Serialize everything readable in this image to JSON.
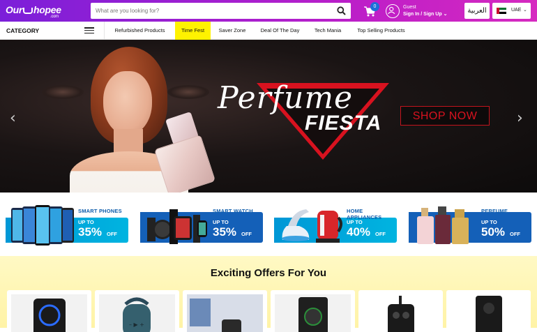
{
  "header": {
    "logo_text": "Our",
    "logo_text2": "hopee",
    "logo_sub": ".com",
    "search_placeholder": "What are you looking for?",
    "cart_count": "0",
    "user_guest": "Guest",
    "user_signin": "Sign In / Sign Up",
    "arabic_label": "العربية",
    "country_label": "UAE",
    "colors": {
      "gradient_start": "#7b1fd9",
      "gradient_end": "#d62ac0"
    }
  },
  "nav": {
    "category_label": "CATEGORY",
    "items": [
      {
        "label": "Refurbished Products",
        "active": false
      },
      {
        "label": "Time Fest",
        "active": true
      },
      {
        "label": "Saver Zone",
        "active": false
      },
      {
        "label": "Deal Of The Day",
        "active": false
      },
      {
        "label": "Tech Mania",
        "active": false
      },
      {
        "label": "Top Selling Products",
        "active": false
      }
    ],
    "active_color": "#fff200"
  },
  "banner": {
    "title_script": "Perfume",
    "title_bold": "FIESTA",
    "cta": "SHOP NOW",
    "prev_icon": "chevron-left-icon",
    "next_icon": "chevron-right-icon",
    "accent_color": "#d8121f"
  },
  "categories": [
    {
      "name": "SMART PHONES",
      "upto": "UP TO",
      "pct": "35%",
      "off": "OFF",
      "icon": "smartphones-image"
    },
    {
      "name": "SMART WATCH",
      "upto": "UP TO",
      "pct": "35%",
      "off": "OFF",
      "icon": "smartwatch-image"
    },
    {
      "name": "HOME APPLIANCES",
      "upto": "UP TO",
      "pct": "40%",
      "off": "OFF",
      "icon": "appliances-image"
    },
    {
      "name": "PERFUME",
      "upto": "UP TO",
      "pct": "50%",
      "off": "OFF",
      "icon": "perfume-image"
    }
  ],
  "offers": {
    "title": "Exciting Offers For You",
    "items": [
      "party-speaker-image",
      "portable-speaker-image",
      "speaker-desk-image",
      "trolley-speaker-image",
      "trolley-speaker-2-image",
      "tower-speaker-image"
    ]
  }
}
